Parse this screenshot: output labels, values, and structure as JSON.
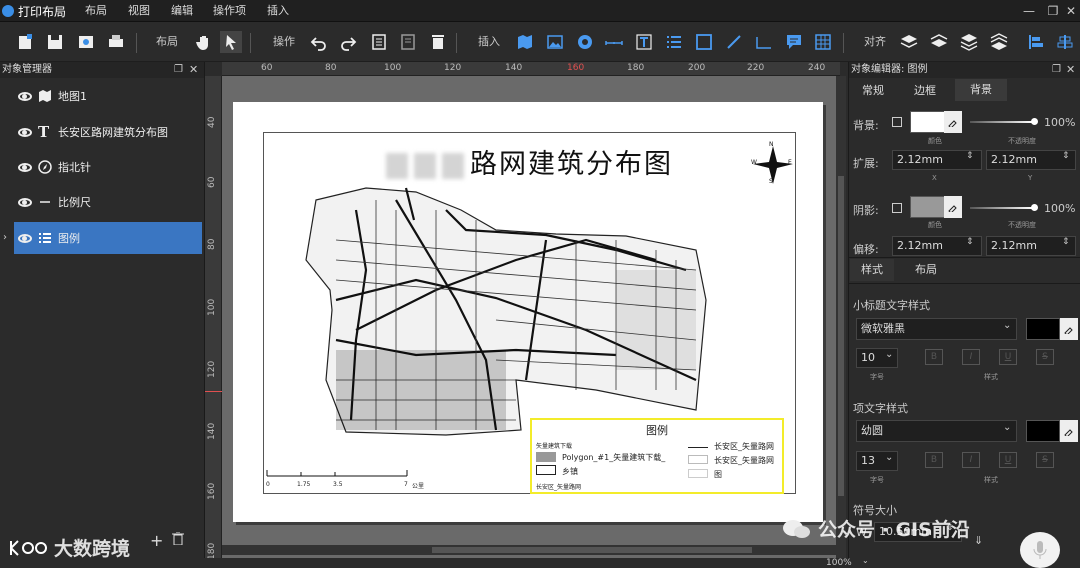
{
  "app": {
    "title": "打印布局"
  },
  "menu": [
    "布局",
    "视图",
    "编辑",
    "操作项",
    "插入"
  ],
  "toolbar": {
    "layout_label": "布局",
    "operation_label": "操作",
    "insert_label": "插入",
    "align_label": "对齐"
  },
  "left_panel": {
    "title": "对象管理器",
    "layers": [
      {
        "label": "地图1",
        "icon": "map-icon"
      },
      {
        "label": "长安区路网建筑分布图",
        "icon": "text-icon"
      },
      {
        "label": "指北针",
        "icon": "compass-icon"
      },
      {
        "label": "比例尺",
        "icon": "scalebar-icon"
      },
      {
        "label": "图例",
        "icon": "legend-icon",
        "selected": true
      }
    ]
  },
  "ruler": {
    "top": [
      "60",
      "80",
      "100",
      "120",
      "140",
      "160",
      "180",
      "200",
      "220",
      "240"
    ],
    "left": [
      "40",
      "60",
      "80",
      "100",
      "120",
      "140",
      "160",
      "180"
    ]
  },
  "map": {
    "title": "路网建筑分布图",
    "north": {
      "n": "N",
      "s": "S",
      "e": "E",
      "w": "W"
    },
    "scalebar": {
      "ticks": [
        "0",
        "1.75",
        "3.5",
        "7"
      ],
      "unit": "公里"
    }
  },
  "legend": {
    "title": "图例",
    "items_left": [
      "矢量建筑下载",
      "Polygon_#1_矢量建筑下载_",
      "乡镇",
      "长安区_矢量路网"
    ],
    "items_right": [
      "长安区_矢量路网",
      "长安区_矢量路网",
      "图"
    ]
  },
  "right_panel": {
    "title": "对象编辑器: 图例",
    "tabs": [
      "常规",
      "边框",
      "背景"
    ],
    "active_tab": "背景",
    "background": {
      "label": "背景:",
      "color_label": "颜色",
      "opacity": "100%",
      "opacity_label": "不透明度"
    },
    "expand": {
      "label": "扩展:",
      "x": "2.12mm",
      "y": "2.12mm",
      "x_label": "X",
      "y_label": "Y"
    },
    "shadow": {
      "label": "阴影:",
      "color_label": "颜色",
      "opacity": "100%",
      "opacity_label": "不透明度"
    },
    "offset": {
      "label": "偏移:",
      "x": "2.12mm",
      "y": "2.12mm"
    },
    "subtabs": [
      "样式",
      "布局"
    ],
    "subtitle_style": {
      "heading": "小标题文字样式",
      "font": "微软雅黑",
      "size": "10",
      "size_label": "字号",
      "style_label": "样式"
    },
    "item_style": {
      "heading": "项文字样式",
      "font": "幼圆",
      "size": "13",
      "size_label": "字号",
      "style_label": "样式"
    },
    "symbol": {
      "heading": "符号大小",
      "w_label": "W",
      "w": "10.50mm"
    }
  },
  "status": {
    "zoom": "100%"
  },
  "watermark": {
    "left": "大数跨境",
    "right": "公众号 · GIS前沿"
  },
  "colors": {
    "accent": "#3a76c2",
    "legend_border": "#f3ec2a",
    "bg": "#2b2b2b"
  }
}
